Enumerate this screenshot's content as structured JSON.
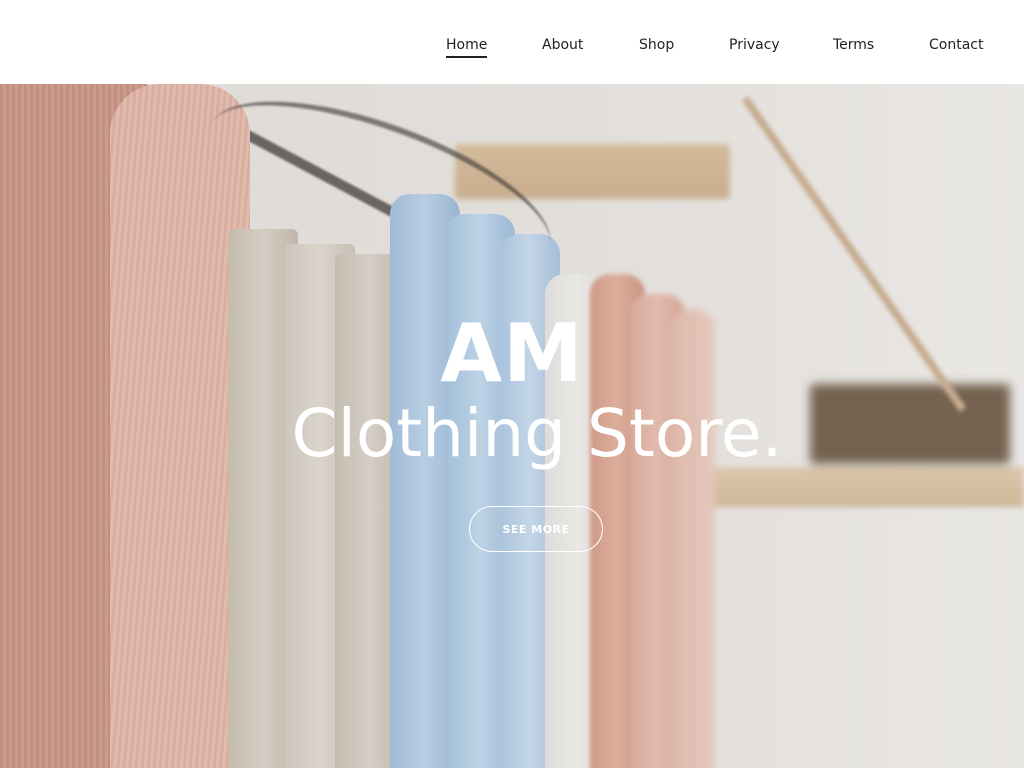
{
  "nav": {
    "items": [
      {
        "label": "Home",
        "active": true
      },
      {
        "label": "About",
        "active": false
      },
      {
        "label": "Shop",
        "active": false
      },
      {
        "label": "Privacy",
        "active": false
      },
      {
        "label": "Terms",
        "active": false
      },
      {
        "label": "Contact",
        "active": false
      }
    ]
  },
  "hero": {
    "title": "AM",
    "subtitle": "Clothing Store.",
    "button_label": "SEE MORE"
  },
  "colors": {
    "header_bg": "#ffffff",
    "nav_text": "#222222",
    "hero_text": "#ffffff",
    "accent_pink": "#d4a394",
    "accent_blue": "#a9c7e4"
  }
}
